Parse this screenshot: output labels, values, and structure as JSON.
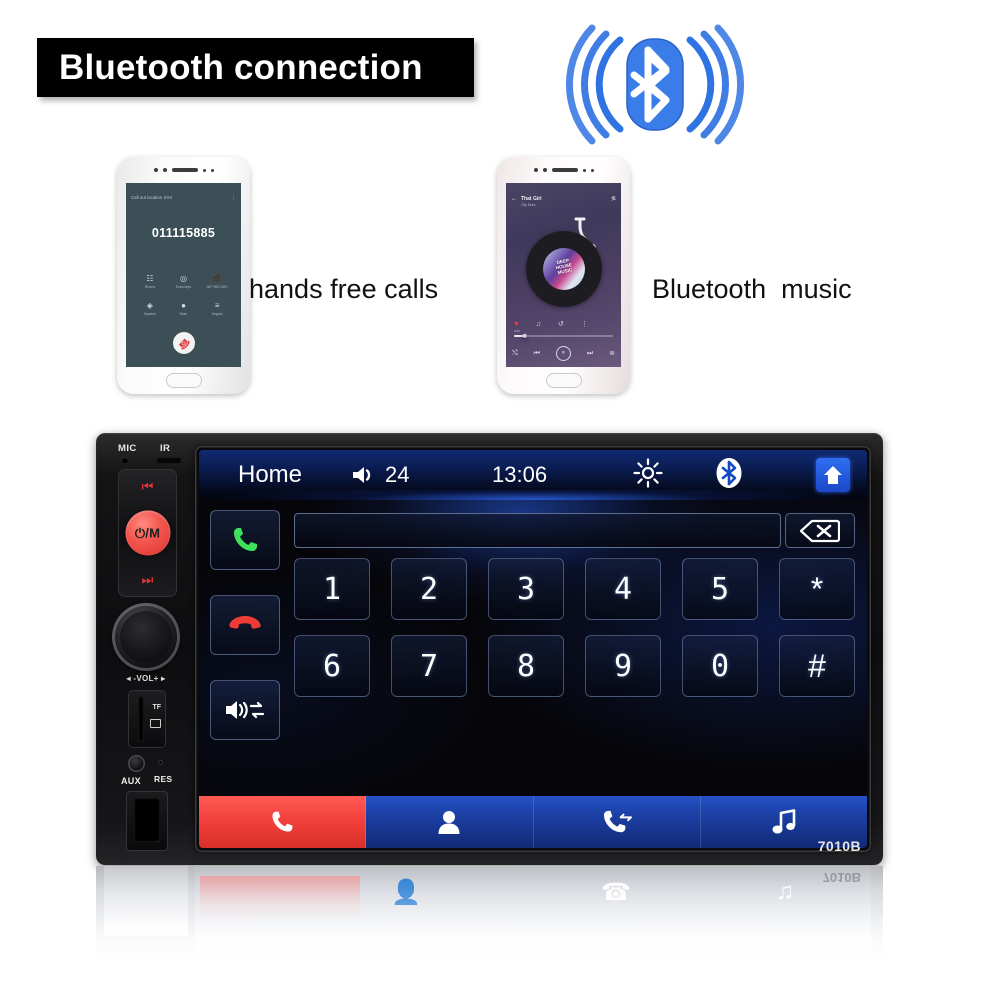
{
  "banner": {
    "title": "Bluetooth connection"
  },
  "bluetooth_logo": {
    "name": "bluetooth-logo",
    "color": "#2a6fe0",
    "wave_count": 3
  },
  "captions": {
    "hands_free": "hands free calls",
    "bluetooth_music": "Bluetooth  music"
  },
  "phone_call": {
    "status_left": "",
    "status_right": "",
    "header": "Call out location  XXX",
    "kebab": "⋮",
    "number": "011115885",
    "actions": [
      {
        "icon": "☷",
        "label": "Record"
      },
      {
        "icon": "◎",
        "label": "Extra keys"
      },
      {
        "icon": "⬛",
        "label": "NET RECORD"
      },
      {
        "icon": "◈",
        "label": "Speaker"
      },
      {
        "icon": "●",
        "label": "Mute"
      },
      {
        "icon": "≡",
        "label": "Keypad"
      }
    ],
    "end_call_icon": "☎"
  },
  "phone_music": {
    "back_icon": "←",
    "title": "That Girl",
    "artist": "Olly Murs",
    "share_icon": "≶",
    "album_art_text": "DEEP\nHOUSE\nMUSIC",
    "heart_icon": "♥",
    "row_icons": [
      "♥",
      "♫",
      "↺",
      "⋮"
    ],
    "progress_percent": 11,
    "elapsed": "0:22",
    "controls": [
      "⤭",
      "⏮",
      "⏸",
      "⏭",
      "≣"
    ]
  },
  "stereo": {
    "model": "7010B",
    "left_panel": {
      "mic_label": "MIC",
      "ir_label": "IR",
      "prev_icon": "⏮",
      "power_label": "⏻/M",
      "next_icon": "⏭",
      "volume_label": "◂ -VOL+ ▸",
      "tf_label": "TF",
      "aux_label": "AUX",
      "res_label": "RES"
    },
    "statusbar": {
      "home_label": "Home",
      "volume_icon": "speaker-icon",
      "volume_value": "24",
      "time": "13:06",
      "brightness_icon": "sun-icon",
      "bluetooth_icon": "bluetooth-icon",
      "home_icon": "home-icon"
    },
    "dialer": {
      "call_icon": "✆",
      "hangup_icon": "✆",
      "speaker_icon": "◀",
      "transfer_icon": "⇄",
      "number_input_value": "",
      "delete_icon": "backspace-icon",
      "keys": [
        "1",
        "2",
        "3",
        "4",
        "5",
        "*",
        "6",
        "7",
        "8",
        "9",
        "0",
        "#"
      ]
    },
    "tabs": [
      {
        "name": "dialpad",
        "icon": "✆",
        "active": true
      },
      {
        "name": "contacts",
        "icon": "👤",
        "active": false
      },
      {
        "name": "call-history",
        "icon": "✆",
        "active": false
      },
      {
        "name": "music",
        "icon": "♫",
        "active": false
      }
    ]
  },
  "colors": {
    "banner_bg": "#000000",
    "bluetooth_blue": "#2a6fe0",
    "accent_red": "#ef3d38",
    "call_green": "#3fe05a",
    "tab_blue": "#1b3ea2",
    "power_red": "#f4564f"
  }
}
